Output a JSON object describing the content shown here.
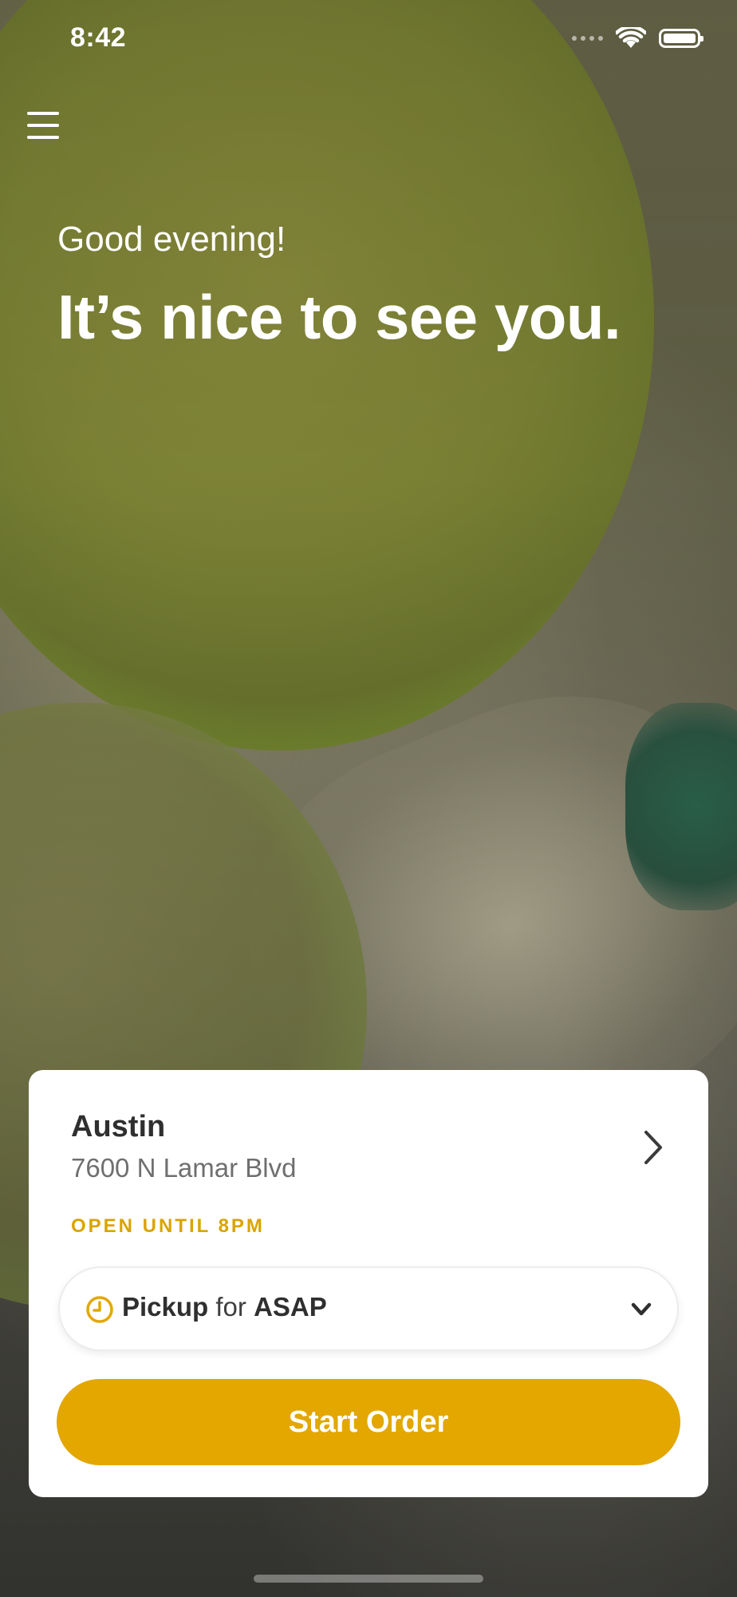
{
  "status_bar": {
    "time": "8:42",
    "icons": [
      "signal-icon",
      "wifi-icon",
      "battery-icon"
    ]
  },
  "header": {
    "menu_icon": "hamburger-menu-icon",
    "greeting": "Good evening!",
    "headline": "It’s nice to see you."
  },
  "location_card": {
    "name": "Austin",
    "address": "7600 N Lamar Blvd",
    "hours": "OPEN UNTIL 8PM",
    "chevron_icon": "chevron-right-icon"
  },
  "order_mode": {
    "mode": "Pickup",
    "connector": "for",
    "time": "ASAP",
    "icon": "clock-icon",
    "dropdown_icon": "chevron-down-icon"
  },
  "actions": {
    "start_order": "Start Order"
  },
  "colors": {
    "accent": "#e3a700",
    "hours_text": "#d9a400",
    "card_bg": "#ffffff",
    "primary_text": "#2f2f2f",
    "secondary_text": "#6f6f6f"
  }
}
